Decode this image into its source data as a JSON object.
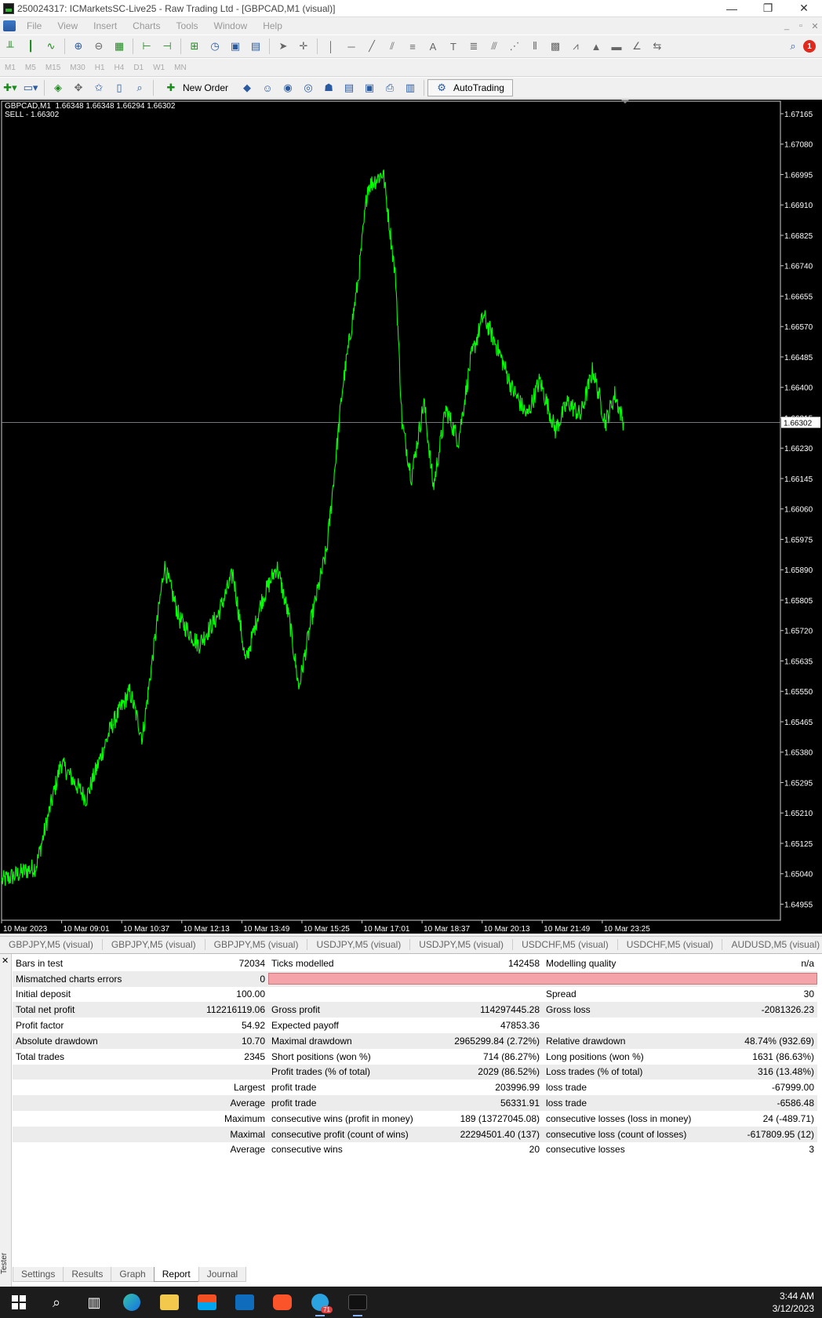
{
  "window": {
    "title": "250024317: ICMarketsSC-Live25 - Raw Trading Ltd - [GBPCAD,M1 (visual)]",
    "minimize": "—",
    "maximize": "❐",
    "close": "✕"
  },
  "menu": {
    "items": [
      "File",
      "View",
      "Insert",
      "Charts",
      "Tools",
      "Window",
      "Help"
    ],
    "mdi_min": "_",
    "mdi_restore": "▫",
    "mdi_close": "✕"
  },
  "timeframes": [
    "M1",
    "M5",
    "M15",
    "M30",
    "H1",
    "H4",
    "D1",
    "W1",
    "MN"
  ],
  "toolbar": {
    "new_order": "New Order",
    "autotrading": "AutoTrading",
    "notification_count": "1"
  },
  "chart": {
    "info_line1": "GBPCAD,M1  1.66348 1.66348 1.66294 1.66302",
    "info_line2": "SELL - 1.66302",
    "current_price": "1.66302",
    "line_color": "#00ff00",
    "background": "#000000"
  },
  "chart_data": {
    "type": "line",
    "title": "GBPCAD,M1",
    "xlabel": "",
    "ylabel": "",
    "ylim": [
      1.6491,
      1.672
    ],
    "grid": false,
    "y_ticks": [
      "1.67165",
      "1.67080",
      "1.66995",
      "1.66910",
      "1.66825",
      "1.66740",
      "1.66655",
      "1.66570",
      "1.66485",
      "1.66400",
      "1.66315",
      "1.66230",
      "1.66145",
      "1.66060",
      "1.65975",
      "1.65890",
      "1.65805",
      "1.65720",
      "1.65635",
      "1.65550",
      "1.65465",
      "1.65380",
      "1.65295",
      "1.65210",
      "1.65125",
      "1.65040",
      "1.64955"
    ],
    "x_ticks": [
      "10 Mar 2023",
      "10 Mar 09:01",
      "10 Mar 10:37",
      "10 Mar 12:13",
      "10 Mar 13:49",
      "10 Mar 15:25",
      "10 Mar 17:01",
      "10 Mar 18:37",
      "10 Mar 20:13",
      "10 Mar 21:49",
      "10 Mar 23:25"
    ],
    "x_start": "10 Mar 2023 07:25",
    "x_end": "10 Mar 2023 23:59",
    "x": [
      "07:25",
      "08:20",
      "09:00",
      "09:40",
      "10:20",
      "10:50",
      "11:10",
      "11:45",
      "12:10",
      "12:40",
      "13:10",
      "13:35",
      "13:55",
      "14:20",
      "14:45",
      "15:05",
      "15:20",
      "15:40",
      "16:05",
      "16:30",
      "16:55",
      "17:10",
      "17:35",
      "17:55",
      "18:05",
      "18:20",
      "18:40",
      "18:55",
      "19:15",
      "19:35",
      "19:55",
      "20:15",
      "20:40",
      "21:00",
      "21:25",
      "21:45",
      "22:10",
      "22:30",
      "22:50",
      "23:10",
      "23:30",
      "23:45",
      "23:59"
    ],
    "series": [
      {
        "name": "GBPCAD",
        "values": [
          1.6502,
          1.6506,
          1.6535,
          1.6525,
          1.6545,
          1.6555,
          1.6542,
          1.659,
          1.6575,
          1.6568,
          1.6576,
          1.6588,
          1.6563,
          1.658,
          1.659,
          1.6575,
          1.6556,
          1.6575,
          1.6595,
          1.664,
          1.667,
          1.6696,
          1.67,
          1.667,
          1.663,
          1.6615,
          1.6636,
          1.6612,
          1.6634,
          1.6625,
          1.6648,
          1.666,
          1.665,
          1.664,
          1.6632,
          1.6642,
          1.6628,
          1.6636,
          1.6632,
          1.6645,
          1.663,
          1.6638,
          1.66302
        ]
      }
    ]
  },
  "chart_tabs": [
    "GBPJPY,M5 (visual)",
    "GBPJPY,M5 (visual)",
    "GBPJPY,M5 (visual)",
    "USDJPY,M5 (visual)",
    "USDJPY,M5 (visual)",
    "USDCHF,M5 (visual)",
    "USDCHF,M5 (visual)",
    "AUDUSD,M5 (visual)"
  ],
  "chart_tab_arrows": [
    "◀",
    "▶"
  ],
  "report": {
    "rows": [
      [
        "Bars in test",
        "72034",
        "Ticks modelled",
        "142458",
        "Modelling quality",
        "n/a"
      ],
      [
        "Mismatched charts errors",
        "0",
        "",
        "",
        "",
        ""
      ],
      [
        "Initial deposit",
        "100.00",
        "",
        "",
        "Spread",
        "30"
      ],
      [
        "Total net profit",
        "112216119.06",
        "Gross profit",
        "114297445.28",
        "Gross loss",
        "-2081326.23"
      ],
      [
        "Profit factor",
        "54.92",
        "Expected payoff",
        "47853.36",
        "",
        ""
      ],
      [
        "Absolute drawdown",
        "10.70",
        "Maximal drawdown",
        "2965299.84 (2.72%)",
        "Relative drawdown",
        "48.74% (932.69)"
      ],
      [
        "Total trades",
        "2345",
        "Short positions (won %)",
        "714 (86.27%)",
        "Long positions (won %)",
        "1631 (86.63%)"
      ],
      [
        "",
        "",
        "Profit trades (% of total)",
        "2029 (86.52%)",
        "Loss trades (% of total)",
        "316 (13.48%)"
      ],
      [
        "",
        "Largest",
        "profit trade",
        "203996.99",
        "loss trade",
        "-67999.00"
      ],
      [
        "",
        "Average",
        "profit trade",
        "56331.91",
        "loss trade",
        "-6586.48"
      ],
      [
        "",
        "Maximum",
        "consecutive wins (profit in money)",
        "189 (13727045.08)",
        "consecutive losses (loss in money)",
        "24 (-489.71)"
      ],
      [
        "",
        "Maximal",
        "consecutive profit (count of wins)",
        "22294501.40 (137)",
        "consecutive loss (count of losses)",
        "-617809.95 (12)"
      ],
      [
        "",
        "Average",
        "consecutive wins",
        "20",
        "consecutive losses",
        "3"
      ]
    ]
  },
  "tester": {
    "side_label": "Tester",
    "close": "✕",
    "tabs": [
      "Settings",
      "Results",
      "Graph",
      "Report",
      "Journal"
    ],
    "active_tab": "Report"
  },
  "taskbar": {
    "time": "3:44 AM",
    "date": "3/12/2023",
    "telegram_badge": "71"
  }
}
